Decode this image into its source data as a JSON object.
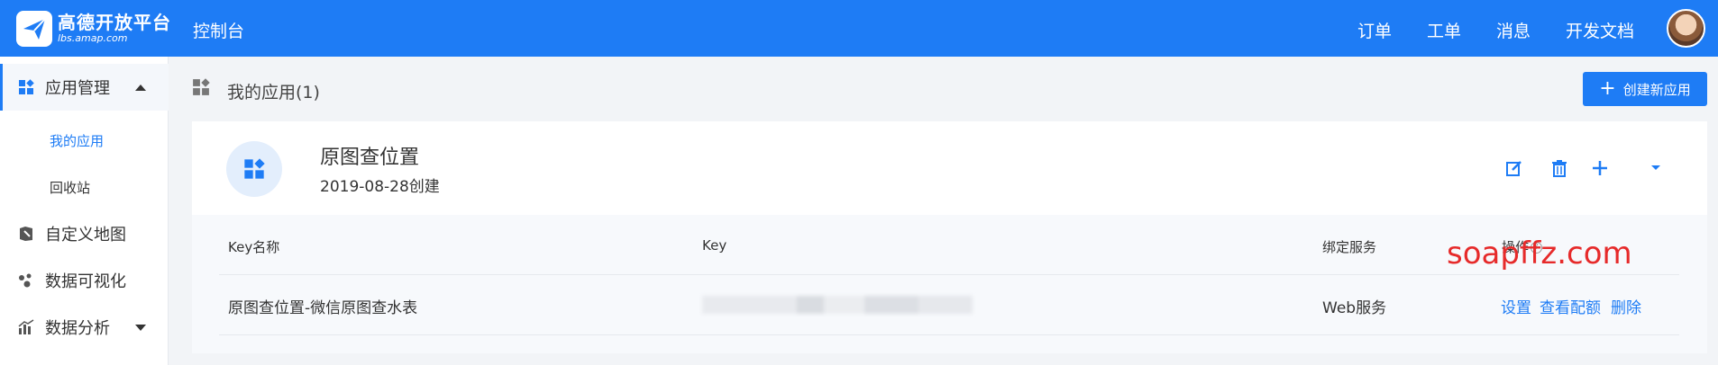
{
  "header": {
    "logo_title": "高德开放平台",
    "logo_sub": "lbs.amap.com",
    "console": "控制台",
    "nav": [
      "订单",
      "工单",
      "消息",
      "开发文档"
    ]
  },
  "sidebar": {
    "items": [
      {
        "label": "应用管理",
        "icon": "app-grid-icon"
      },
      {
        "label": "自定义地图",
        "icon": "map-icon"
      },
      {
        "label": "数据可视化",
        "icon": "visualization-icon"
      },
      {
        "label": "数据分析",
        "icon": "chart-icon"
      }
    ],
    "sub": [
      "我的应用",
      "回收站"
    ]
  },
  "page": {
    "title": "我的应用(1)",
    "create_label": "创建新应用"
  },
  "app": {
    "name": "原图查位置",
    "created": "2019-08-28创建"
  },
  "table": {
    "headers": [
      "Key名称",
      "Key",
      "绑定服务",
      "操作"
    ],
    "row": {
      "name": "原图查位置-微信原图查水表",
      "service": "Web服务",
      "actions": [
        "设置",
        "查看配额",
        "删除"
      ]
    }
  },
  "watermark": "soapffz.com",
  "colors": {
    "accent": "#1e7cf5",
    "watermark": "#e62a2a"
  }
}
